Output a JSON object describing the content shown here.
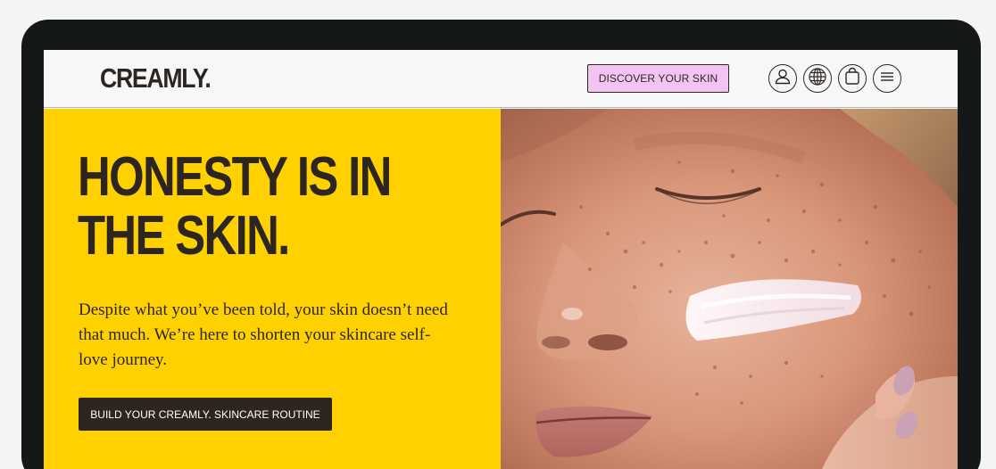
{
  "brand": {
    "logo": "CREAMLY."
  },
  "header": {
    "discover_label": "DISCOVER YOUR SKIN",
    "icons": [
      "account-icon",
      "globe-icon",
      "bag-icon",
      "menu-icon"
    ]
  },
  "hero": {
    "headline_line1": "HONESTY IS IN",
    "headline_line2": "THE SKIN.",
    "body": "Despite what you’ve been told, your skin doesn’t need that much. We’re here to shorten your skincare self-love journey.",
    "cta_label": "BUILD YOUR CREAMLY. SKINCARE ROUTINE",
    "image": "close-up face with cream swatch on cheek"
  },
  "colors": {
    "hero_yellow": "#ffd100",
    "discover_pink": "#f3c4f2",
    "ink": "#2d2620",
    "device_frame": "#141819"
  }
}
